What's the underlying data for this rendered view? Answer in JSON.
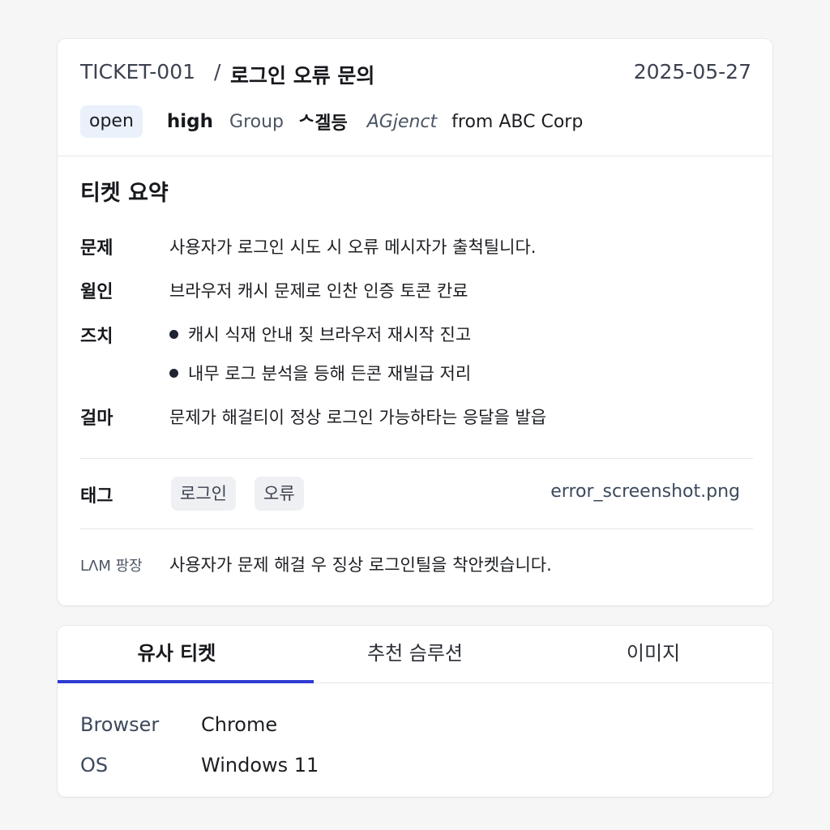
{
  "ticket": {
    "id": "TICKET-001",
    "separator": "/",
    "title": "로그인 오류 문의",
    "date": "2025-05-27",
    "status": "open",
    "priority": "high",
    "group_label": "Group",
    "group_name": "ᄉ겔등",
    "agent": "AGjenct",
    "from": "from ABC Corp"
  },
  "summary": {
    "title": "티켓 요약",
    "problem_label": "문제",
    "problem": "사용자가 로그인 시도 시 오류 메시자가 출척틸니다.",
    "cause_label": "윌인",
    "cause": "브라우저 캐시 문제로 인찬 인증 토콘 칸료",
    "action_label": "즈치",
    "actions": [
      "캐시 식재 안내 짖 브라우저 재시작 진고",
      "내무 로그 분석을 등해 든콘 재빌급 저리"
    ],
    "result_label": "걸마",
    "result": "문제가 해걸티이 정상 로그인 가능하타는 응달을 발읍"
  },
  "tags": {
    "label": "태그",
    "items": [
      "로그인",
      "오류"
    ],
    "attachment": "error_screenshot.png"
  },
  "llm": {
    "label": "LᐱM 팡장",
    "text": "사용자가 문제 해걸 우 징상 로그인틸을 착안켓습니다."
  },
  "tabs": [
    "유사 티켓",
    "추천 슴루션",
    "이미지"
  ],
  "details": [
    {
      "key": "Browser",
      "value": "Chrome"
    },
    {
      "key": "OS",
      "value": "Windows 11"
    }
  ],
  "colors": {
    "accent": "#2f3bd0",
    "badge_bg": "#eaf1fb"
  }
}
